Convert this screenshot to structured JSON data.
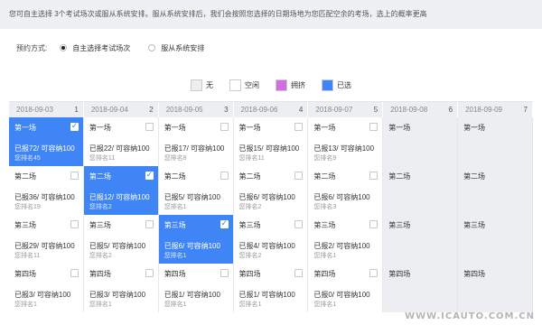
{
  "notice": "您可自主选择 3个考试场次或服从系统安排。服从系统安排后，我们会按照您选择的日期场地为您匹配空余的考场，选上的概率更高",
  "booking": {
    "label": "预约方式:",
    "options": [
      {
        "label": "自主选择考试场次",
        "selected": true
      },
      {
        "label": "服从系统安排",
        "selected": false
      }
    ]
  },
  "legend": [
    {
      "label": "无",
      "color": "#eceef1"
    },
    {
      "label": "空闲",
      "color": "#ffffff"
    },
    {
      "label": "拥挤",
      "color": "#d36ee0"
    },
    {
      "label": "已选",
      "color": "#3f85f5"
    }
  ],
  "columns": [
    {
      "date": "2018-09-03",
      "num": "1"
    },
    {
      "date": "2018-09-04",
      "num": "2"
    },
    {
      "date": "2018-09-05",
      "num": "3"
    },
    {
      "date": "2018-09-06",
      "num": "4"
    },
    {
      "date": "2018-09-07",
      "num": "5"
    },
    {
      "date": "2018-09-08",
      "num": "6"
    },
    {
      "date": "2018-09-09",
      "num": "7"
    }
  ],
  "rows": [
    [
      {
        "name": "第一场",
        "cap": "已报72/ 可容纳100",
        "rank": "您排名45",
        "state": "selected"
      },
      {
        "name": "第一场",
        "cap": "已报22/ 可容纳100",
        "rank": "您排名11",
        "state": "free"
      },
      {
        "name": "第一场",
        "cap": "已报17/ 可容纳100",
        "rank": "您排名8",
        "state": "free"
      },
      {
        "name": "第一场",
        "cap": "已报15/ 可容纳100",
        "rank": "您排名11",
        "state": "free"
      },
      {
        "name": "第一场",
        "cap": "已报13/ 可容纳100",
        "rank": "您排名9",
        "state": "free"
      },
      {
        "name": "第一场",
        "cap": "",
        "rank": "",
        "state": "unavail"
      },
      {
        "name": "第一场",
        "cap": "",
        "rank": "",
        "state": "unavail"
      }
    ],
    [
      {
        "name": "第二场",
        "cap": "已报36/ 可容纳100",
        "rank": "您排名19",
        "state": "free"
      },
      {
        "name": "第二场",
        "cap": "已报12/ 可容纳100",
        "rank": "您排名2",
        "state": "selected"
      },
      {
        "name": "第二场",
        "cap": "已报5/ 可容纳100",
        "rank": "您排名1",
        "state": "free"
      },
      {
        "name": "第二场",
        "cap": "已报6/ 可容纳100",
        "rank": "您排名2",
        "state": "free"
      },
      {
        "name": "第二场",
        "cap": "已报6/ 可容纳100",
        "rank": "您排名3",
        "state": "free"
      },
      {
        "name": "第二场",
        "cap": "",
        "rank": "",
        "state": "unavail"
      },
      {
        "name": "第二场",
        "cap": "",
        "rank": "",
        "state": "unavail"
      }
    ],
    [
      {
        "name": "第三场",
        "cap": "已报29/ 可容纳100",
        "rank": "您排名11",
        "state": "free"
      },
      {
        "name": "第三场",
        "cap": "已报5/ 可容纳100",
        "rank": "您排名2",
        "state": "free"
      },
      {
        "name": "第三场",
        "cap": "已报6/ 可容纳100",
        "rank": "您排名1",
        "state": "selected"
      },
      {
        "name": "第三场",
        "cap": "已报4/ 可容纳100",
        "rank": "您排名2",
        "state": "free"
      },
      {
        "name": "第三场",
        "cap": "已报2/ 可容纳100",
        "rank": "您排名1",
        "state": "free"
      },
      {
        "name": "第三场",
        "cap": "",
        "rank": "",
        "state": "unavail"
      },
      {
        "name": "第三场",
        "cap": "",
        "rank": "",
        "state": "unavail"
      }
    ],
    [
      {
        "name": "第四场",
        "cap": "已报3/ 可容纳100",
        "rank": "您排名1",
        "state": "free"
      },
      {
        "name": "第四场",
        "cap": "已报3/ 可容纳100",
        "rank": "您排名1",
        "state": "free"
      },
      {
        "name": "第四场",
        "cap": "已报1/ 可容纳100",
        "rank": "您排名1",
        "state": "free"
      },
      {
        "name": "第四场",
        "cap": "已报1/ 可容纳100",
        "rank": "您排名1",
        "state": "free"
      },
      {
        "name": "第四场",
        "cap": "已报0/ 可容纳100",
        "rank": "您排名1",
        "state": "free"
      },
      {
        "name": "第四场",
        "cap": "",
        "rank": "",
        "state": "unavail"
      },
      {
        "name": "第四场",
        "cap": "",
        "rank": "",
        "state": "unavail"
      }
    ]
  ],
  "watermark": "WWW.ICAUTO.COM.CN"
}
